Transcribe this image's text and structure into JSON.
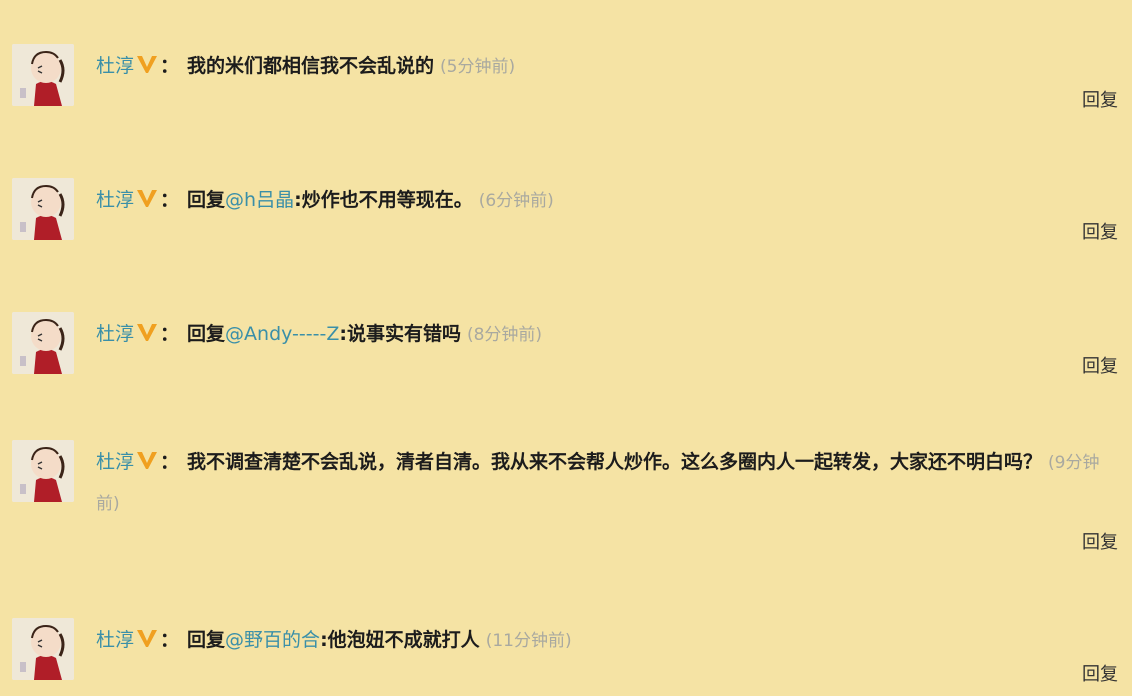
{
  "comments": [
    {
      "author": "杜淳",
      "reply_prefix": "",
      "mention": "",
      "mention_sep": "",
      "text": "我的米们都相信我不会乱说的",
      "time": "(5分钟前)",
      "reply_label": "回复"
    },
    {
      "author": "杜淳",
      "reply_prefix": "回复",
      "mention": "@h吕晶",
      "mention_sep": ":",
      "text": "炒作也不用等现在。",
      "time": "(6分钟前)",
      "reply_label": "回复"
    },
    {
      "author": "杜淳",
      "reply_prefix": "回复",
      "mention": "@Andy-----Z",
      "mention_sep": ":",
      "text": "说事实有错吗",
      "time": "(8分钟前)",
      "reply_label": "回复"
    },
    {
      "author": "杜淳",
      "reply_prefix": "",
      "mention": "",
      "mention_sep": "",
      "text": "我不调查清楚不会乱说，清者自清。我从来不会帮人炒作。这么多圈内人一起转发，大家还不明白吗？",
      "time": "(9分钟前)",
      "reply_label": "回复"
    },
    {
      "author": "杜淳",
      "reply_prefix": "回复",
      "mention": "@野百的合",
      "mention_sep": ":",
      "text": "他泡妞不成就打人",
      "time": "(11分钟前)",
      "reply_label": "回复"
    }
  ],
  "colors": {
    "background": "#f5e3a4",
    "link": "#3a8fa8",
    "vip_badge": "#f0a020",
    "timestamp": "#a9a9a0"
  },
  "icons": {
    "avatar": "avatar-cartoon",
    "vip": "vip-v-badge"
  },
  "colon": "："
}
